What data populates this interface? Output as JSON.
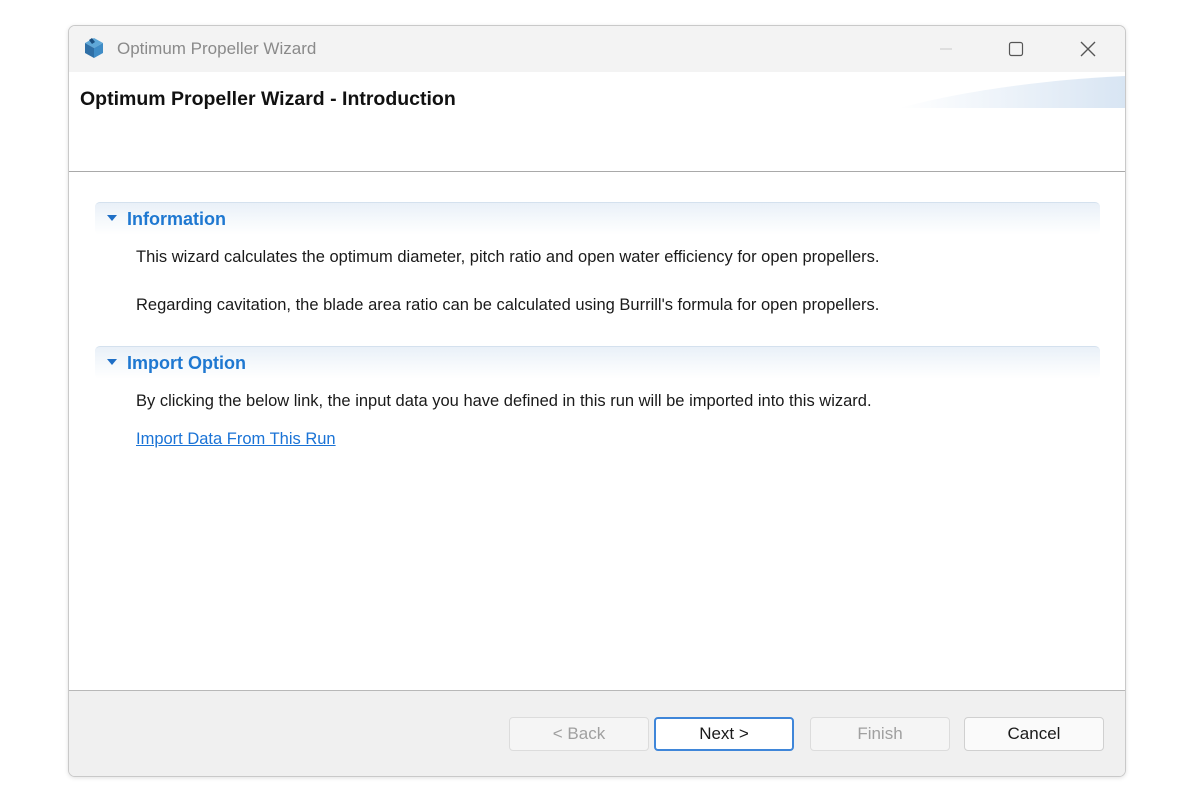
{
  "window": {
    "title": "Optimum Propeller Wizard",
    "app_icon": "propeller-app-icon",
    "controls": [
      "minimize-icon",
      "maximize-icon",
      "close-icon"
    ]
  },
  "header": {
    "title": "Optimum Propeller Wizard - Introduction"
  },
  "sections": {
    "information": {
      "label": "Information",
      "paragraphs": [
        "This wizard calculates the optimum diameter, pitch ratio and open water efficiency for open propellers.",
        "Regarding cavitation, the blade area ratio can be calculated using Burrill's formula for open propellers."
      ]
    },
    "import_option": {
      "label": "Import Option",
      "paragraph": "By clicking the below link, the input data you have defined in this run will be imported into this wizard.",
      "link": "Import Data From This Run"
    }
  },
  "buttons": {
    "back": "< Back",
    "next": "Next >",
    "finish": "Finish",
    "cancel": "Cancel"
  },
  "colors": {
    "accent_text": "#1f78d1",
    "link": "#1a73d6",
    "primary_button_border": "#3f86d9",
    "disabled_text": "#a0a0a0"
  }
}
